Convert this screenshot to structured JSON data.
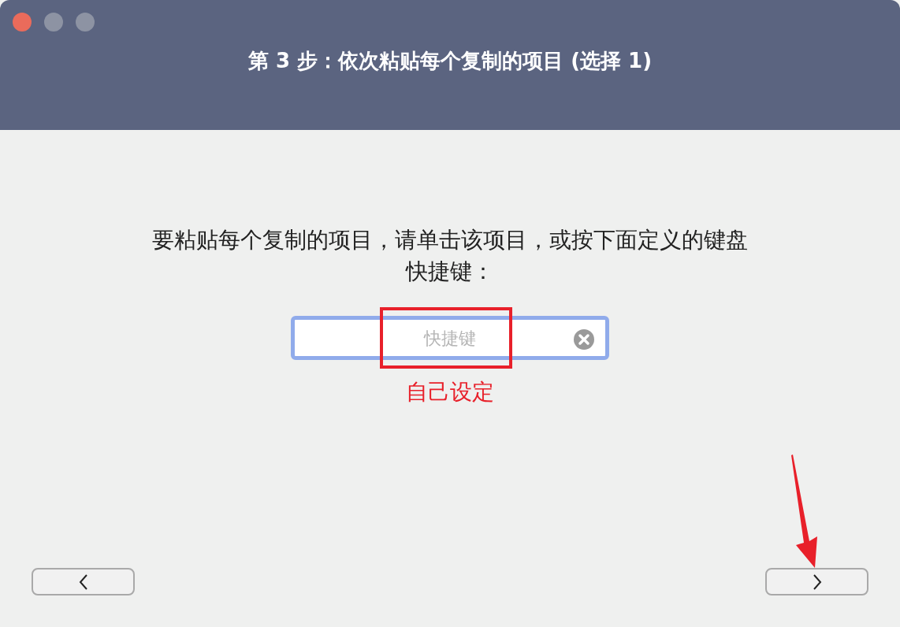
{
  "window": {
    "title": "第 3 步：依次粘贴每个复制的项目 (选择 1)"
  },
  "prompt": "要粘贴每个复制的项目，请单击该项目，或按下面定义的键盘快捷键：",
  "shortcut_field": {
    "placeholder": "快捷键"
  },
  "annotation": "自己设定",
  "nav": [
    {
      "kind": "back"
    },
    {
      "kind": "forward"
    }
  ]
}
